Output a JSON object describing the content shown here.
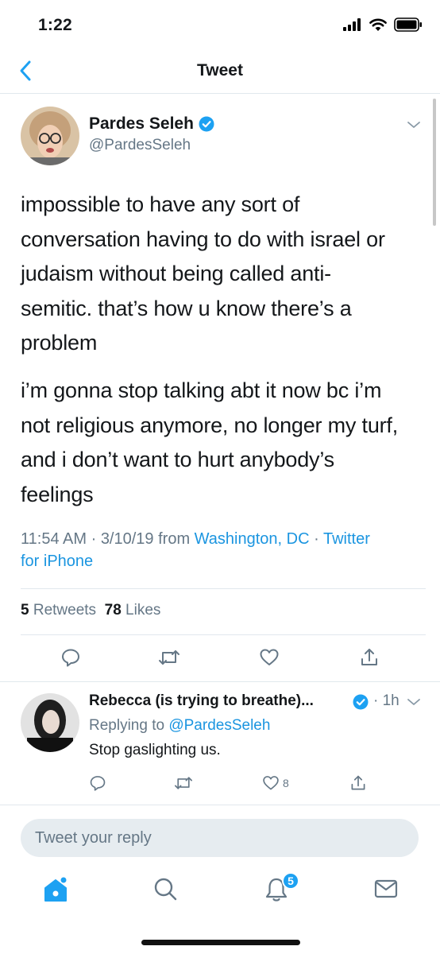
{
  "status_bar": {
    "time": "1:22"
  },
  "nav": {
    "title": "Tweet"
  },
  "tweet": {
    "author_name": "Pardes Seleh",
    "author_handle": "@PardesSeleh",
    "paragraph_1_lines": [
      "impossible to have any sort of",
      "conversation having to do with israel or",
      "judaism without being called anti-",
      "semitic. that’s how u know there’s a",
      "problem"
    ],
    "paragraph_2_lines": [
      "i’m gonna stop talking abt it now bc i’m",
      "not religious anymore, no longer my turf,",
      "and i don’t want to hurt anybody’s",
      "feelings"
    ],
    "time": "11:54 AM",
    "date": "3/10/19",
    "from_label": "from",
    "location": "Washington, DC",
    "source_part1": "Twitter",
    "source_part2": "for iPhone",
    "retweet_count": "5",
    "retweet_label": "Retweets",
    "like_count": "78",
    "like_label": "Likes"
  },
  "reply": {
    "author_name": "Rebecca (is trying to breathe)...",
    "time": "1h",
    "replying_to_label": "Replying to",
    "replying_to_handle": "@PardesSeleh",
    "text": "Stop gaslighting us.",
    "like_count": "8"
  },
  "compose": {
    "placeholder": "Tweet your reply"
  },
  "tab_bar": {
    "notification_count": "5"
  },
  "colors": {
    "accent": "#1da1f2",
    "link": "#1b95e0",
    "secondary_text": "#657786",
    "divider": "#e1e8ed"
  }
}
